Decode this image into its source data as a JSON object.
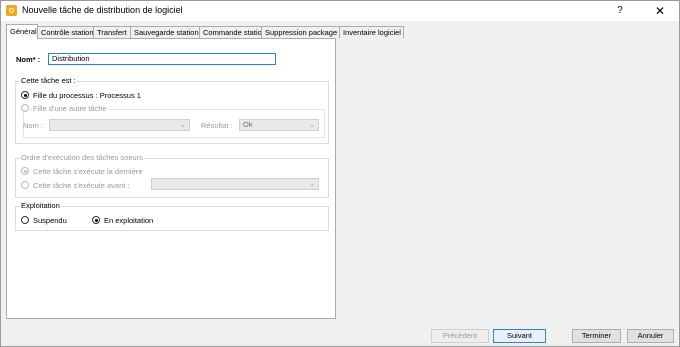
{
  "window": {
    "title": "Nouvelle tâche de distribution de logiciel",
    "help": "?",
    "close": "✕"
  },
  "tabs": [
    {
      "label": "Général",
      "active": true
    },
    {
      "label": "Contrôle station"
    },
    {
      "label": "Transfert"
    },
    {
      "label": "Sauvegarde station"
    },
    {
      "label": "Commande station"
    },
    {
      "label": "Suppression package"
    },
    {
      "label": "Inventaire logiciel"
    }
  ],
  "general": {
    "name_label": "Nom* :",
    "name_value": "Distribution",
    "task_group": {
      "title": "Cette tâche est :",
      "child_of_process": "Fille du processus : Processus 1",
      "child_of_task": "Fille d'une autre tâche",
      "nom_label": "Nom :",
      "nom_value": "",
      "result_label": "Résultat :",
      "result_value": "Ok",
      "selected": "child_of_process"
    },
    "order_group": {
      "title": "Ordre d'exécution des tâches soeurs",
      "last": "Cette tâche s'exécute la dernière",
      "before": "Cette tâche s'exécute avant :",
      "before_value": "",
      "selected": "last",
      "enabled": false
    },
    "exploitation_group": {
      "title": "Exploitation",
      "suspended": "Suspendu",
      "running": "En exploitation",
      "selected": "running"
    }
  },
  "buttons": {
    "previous": "Précédent",
    "next": "Suivant",
    "finish": "Terminer",
    "cancel": "Annuler"
  },
  "colors": {
    "accent": "#3c7fb1",
    "textbox_focus": "#2f7fd0",
    "app_icon": "#f3a81a"
  }
}
